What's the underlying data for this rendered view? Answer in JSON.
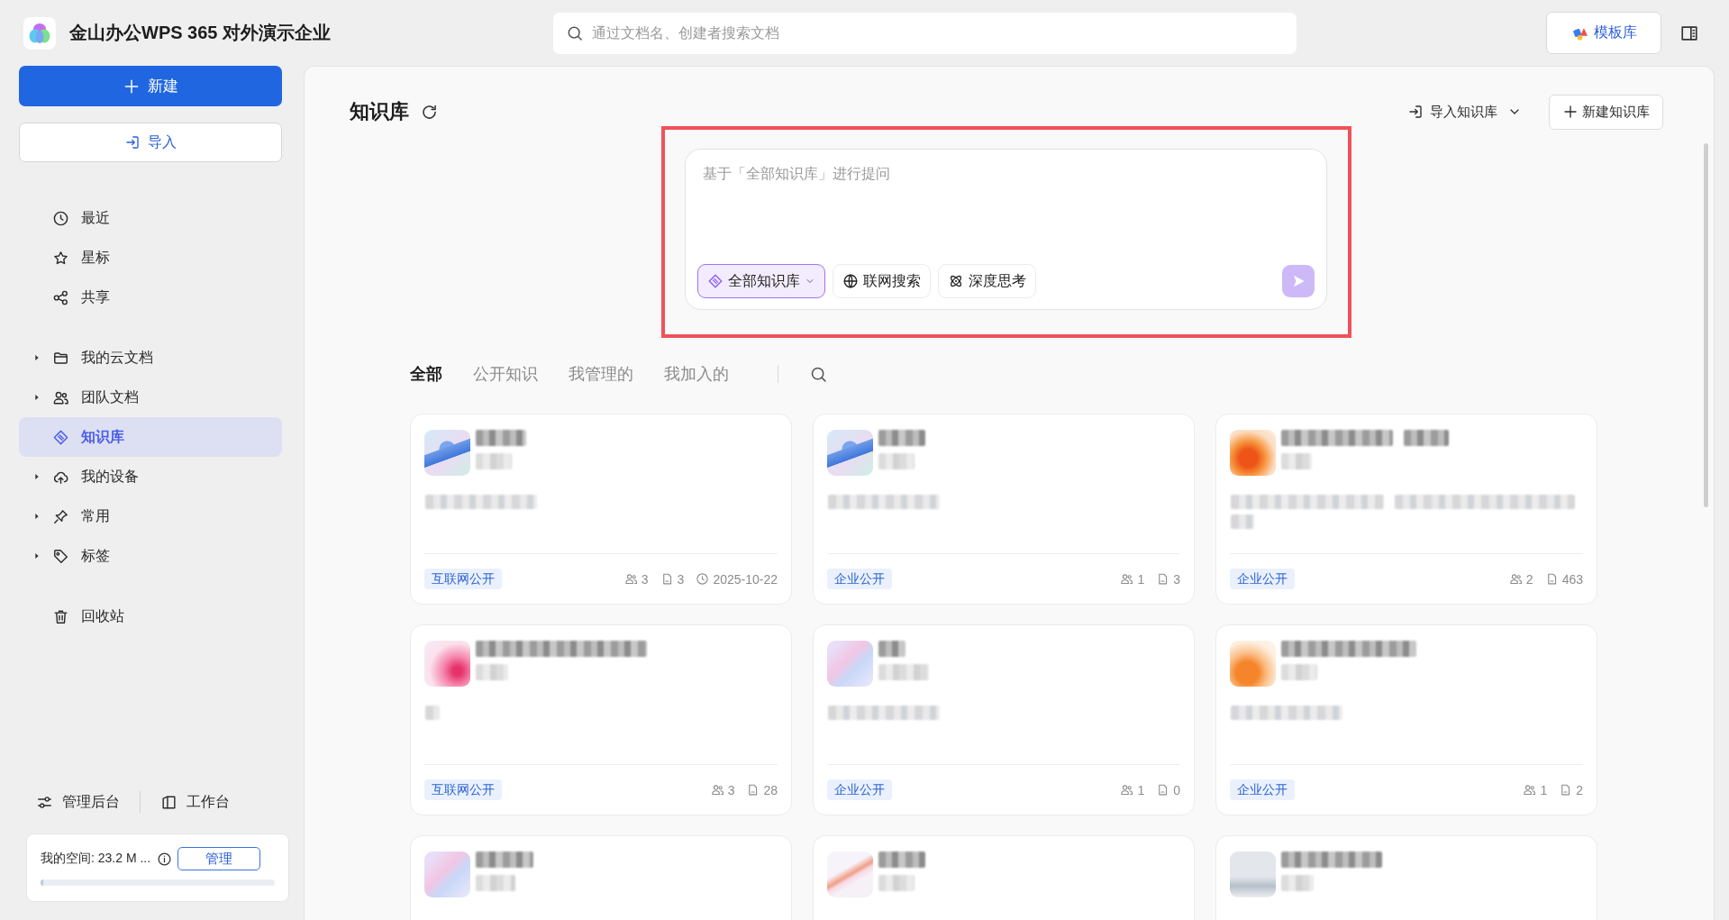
{
  "header": {
    "title": "金山办公WPS 365 对外演示企业",
    "search_placeholder": "通过文档名、创建者搜索文档",
    "template_button": "模板库"
  },
  "sidebar": {
    "new_button": "新建",
    "import_button": "导入",
    "groups": [
      [
        {
          "label": "最近",
          "selected": false
        },
        {
          "label": "星标",
          "selected": false
        },
        {
          "label": "共享",
          "selected": false
        }
      ],
      [
        {
          "label": "我的云文档",
          "selected": false,
          "expanded": false
        },
        {
          "label": "团队文档",
          "selected": false,
          "expanded": false
        },
        {
          "label": "知识库",
          "selected": true
        },
        {
          "label": "我的设备",
          "selected": false,
          "expanded": false
        },
        {
          "label": "常用",
          "selected": false,
          "expanded": false
        },
        {
          "label": "标签",
          "selected": false,
          "expanded": false
        }
      ],
      [
        {
          "label": "回收站",
          "selected": false
        }
      ]
    ],
    "footer_links": [
      "管理后台",
      "工作台"
    ],
    "storage": {
      "label": "我的空间: 23.2 M ...",
      "button": "管理",
      "level": 0.01
    }
  },
  "page": {
    "title": "知识库",
    "import_menu": "导入知识库",
    "new_button": "新建知识库"
  },
  "ask_box": {
    "highlighted": true,
    "placeholder": "基于「全部知识库」进行提问",
    "chips": [
      {
        "label": "全部知识库",
        "kind": "scope",
        "selected": true
      },
      {
        "label": "联网搜索",
        "kind": "web",
        "selected": false
      },
      {
        "label": "深度思考",
        "kind": "reasoning",
        "selected": false
      }
    ],
    "send_disabled": true
  },
  "filter_tabs": [
    {
      "label": "全部",
      "selected": true
    },
    {
      "label": "公开知识",
      "selected": false
    },
    {
      "label": "我管理的",
      "selected": false
    },
    {
      "label": "我加入的",
      "selected": false
    }
  ],
  "cards": [
    {
      "tag": "互联网公开",
      "members": "3",
      "documents": "3",
      "date": "2025-10-22"
    },
    {
      "tag": "企业公开",
      "members": "1",
      "documents": "3"
    },
    {
      "tag": "企业公开",
      "members": "2",
      "documents": "463"
    },
    {
      "tag": "互联网公开",
      "members": "3",
      "documents": "28"
    },
    {
      "tag": "企业公开",
      "members": "1",
      "documents": "0"
    },
    {
      "tag": "企业公开",
      "members": "1",
      "documents": "2"
    }
  ]
}
